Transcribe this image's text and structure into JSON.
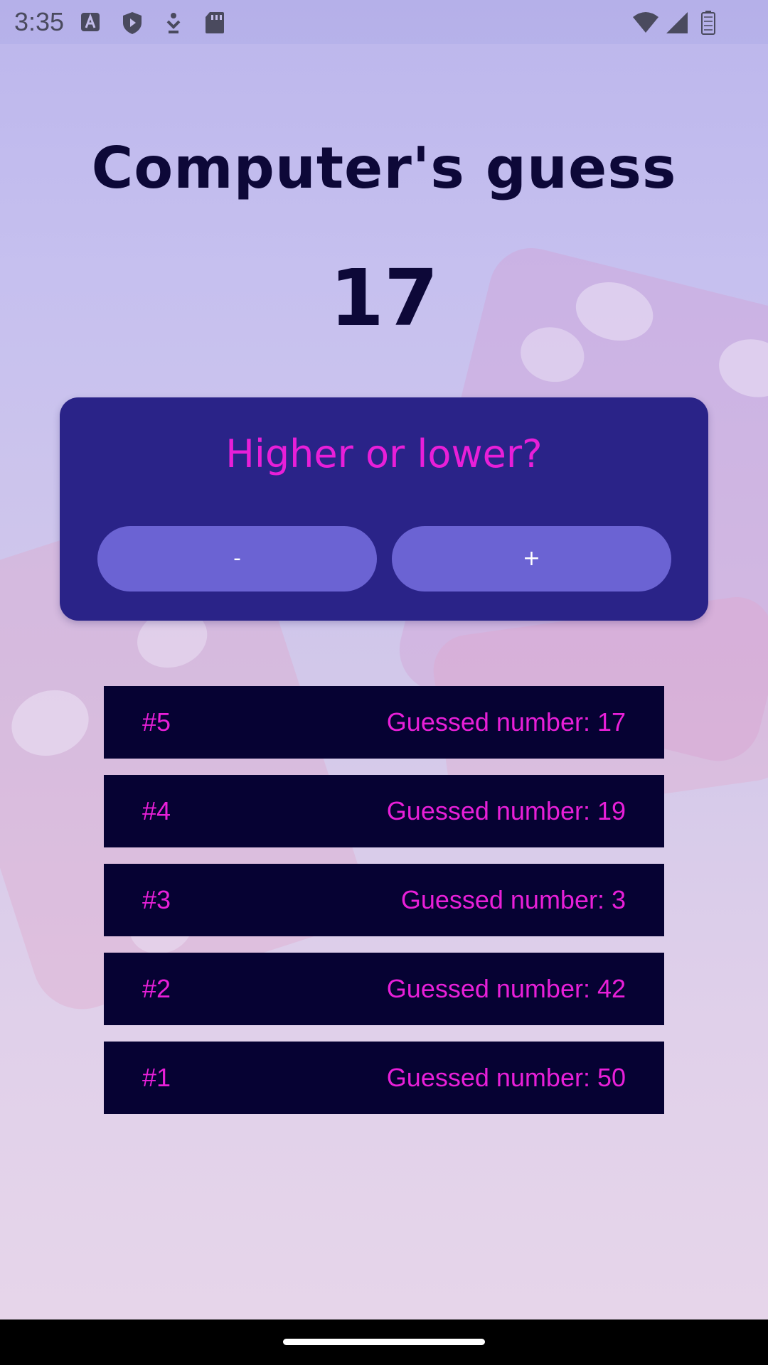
{
  "status_bar": {
    "time": "3:35",
    "icons": [
      "text-a-icon",
      "shield-icon",
      "download-icon",
      "sd-card-icon",
      "wifi-icon",
      "signal-icon",
      "battery-icon"
    ]
  },
  "screen": {
    "title": "Computer's guess",
    "current_guess": "17"
  },
  "card": {
    "prompt": "Higher or lower?",
    "minus_label": "-",
    "plus_label": "+"
  },
  "log": [
    {
      "index": "#5",
      "text": "Guessed number: 17"
    },
    {
      "index": "#4",
      "text": "Guessed number: 19"
    },
    {
      "index": "#3",
      "text": "Guessed number: 3"
    },
    {
      "index": "#2",
      "text": "Guessed number: 42"
    },
    {
      "index": "#1",
      "text": "Guessed number: 50"
    }
  ],
  "colors": {
    "title": "#0d0838",
    "card_bg": "#2a2388",
    "button_bg": "#6b63d3",
    "accent_magenta": "#e81fd8",
    "log_item_bg": "#060233"
  }
}
